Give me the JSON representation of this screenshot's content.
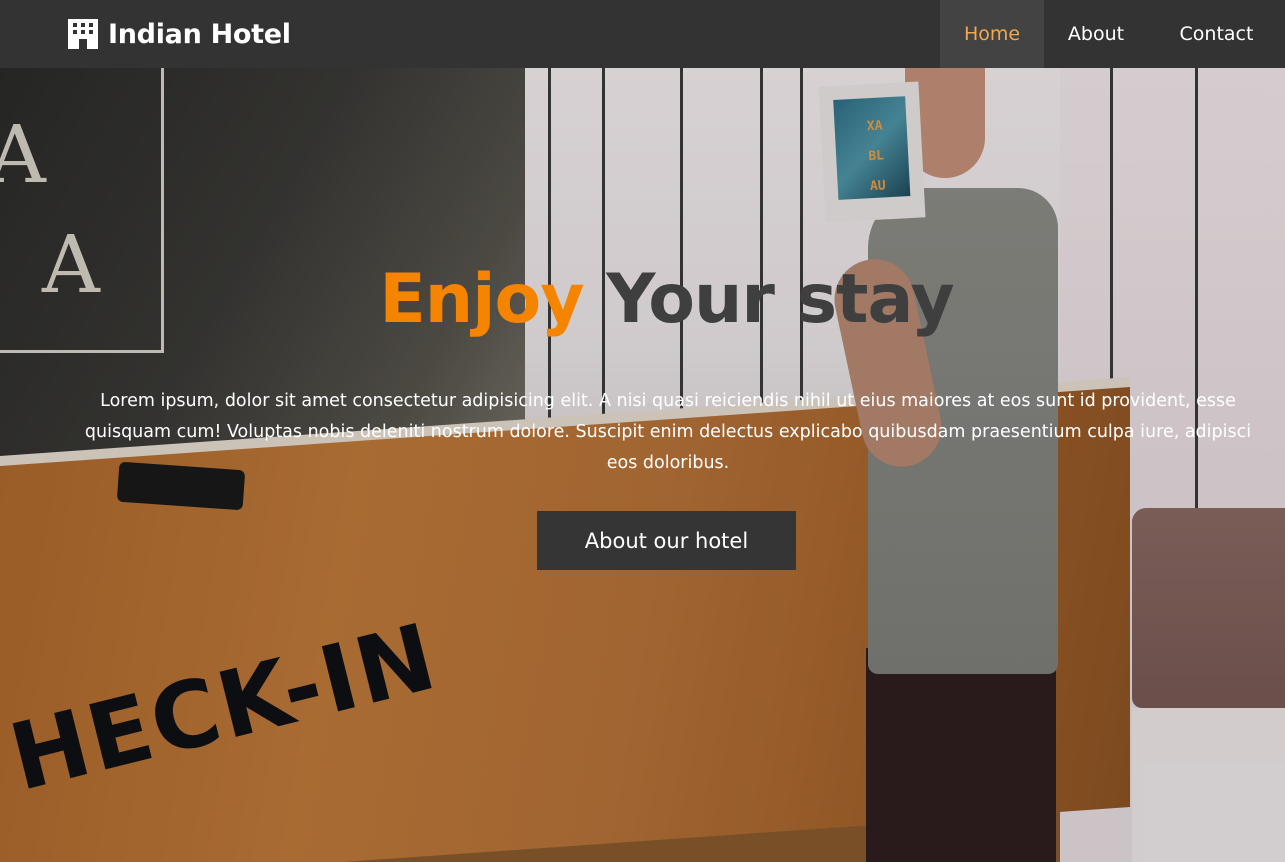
{
  "brand": {
    "icon": "hotel-building-icon",
    "name": "Indian Hotel"
  },
  "nav": {
    "items": [
      {
        "label": "Home",
        "active": true
      },
      {
        "label": "About",
        "active": false
      },
      {
        "label": "Contact",
        "active": false
      }
    ],
    "active_color": "#f0a94e"
  },
  "hero": {
    "title_accent": "Enjoy",
    "title_rest": "Your stay",
    "accent_color": "#f58400",
    "description": "Lorem ipsum, dolor sit amet consectetur adipisicing elit. A nisi quasi reiciendis nihil ut eius maiores at eos sunt id provident, esse quisquam cum! Voluptas nobis deleniti nostrum dolore. Suscipit enim delectus explicabo quibusdam praesentium culpa iure, adipisci eos doloribus.",
    "button_label": "About our hotel",
    "background": {
      "sign_letters": [
        "A",
        "A"
      ],
      "book_text": [
        "XA",
        "BL",
        "AU"
      ],
      "counter_text": "HECK-IN"
    }
  },
  "colors": {
    "navbar": "#333333",
    "button": "#353535"
  }
}
